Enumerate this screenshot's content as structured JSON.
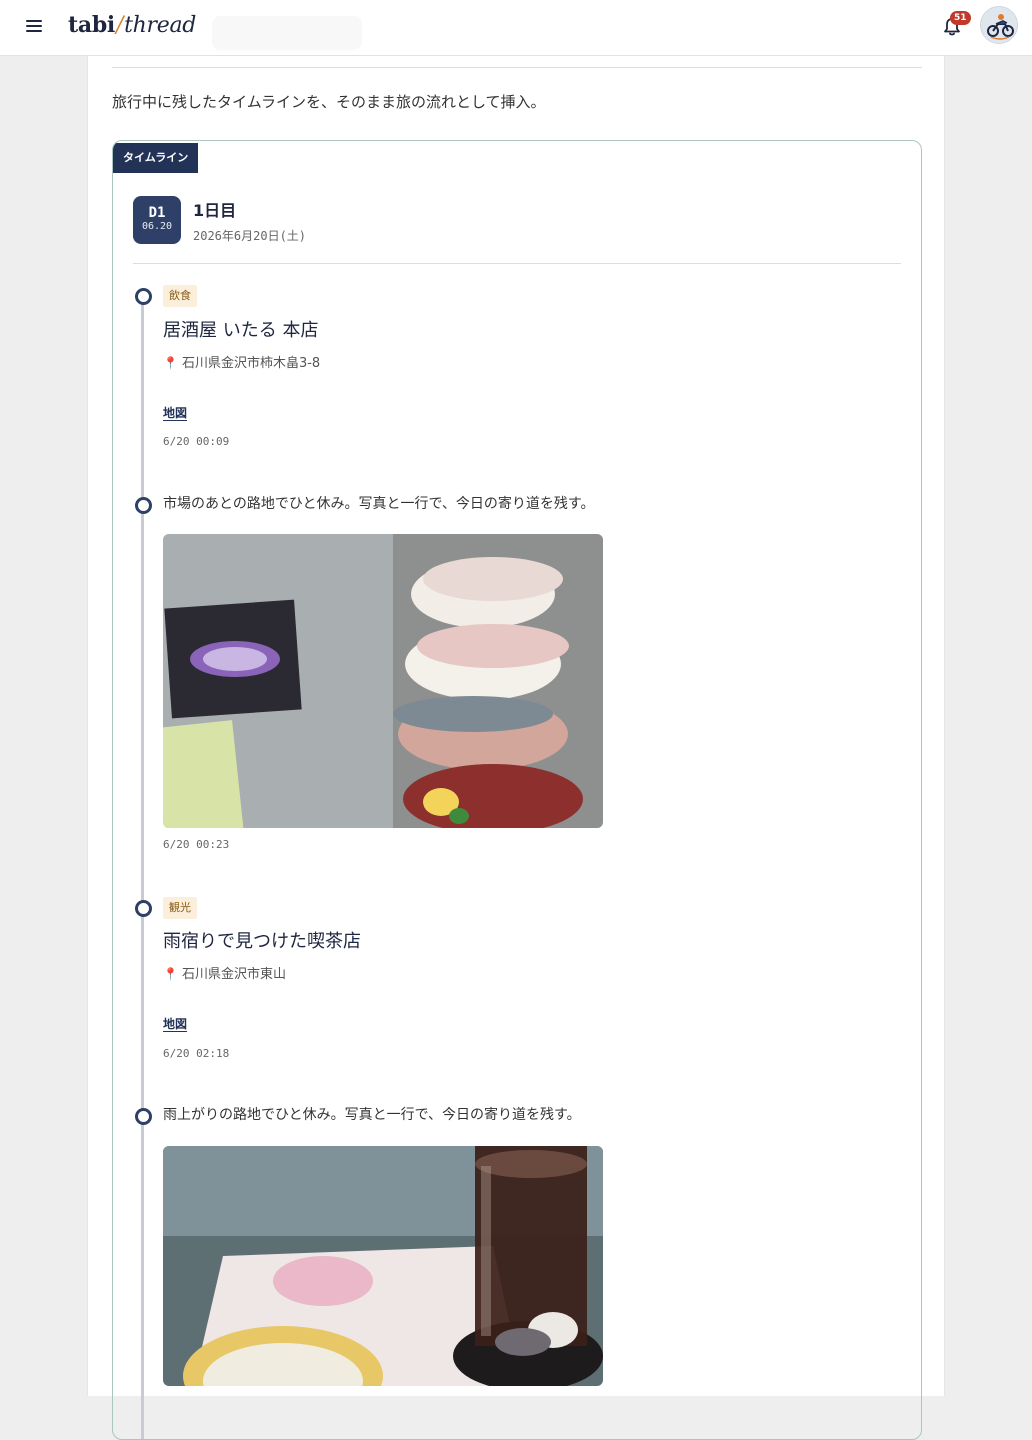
{
  "app": {
    "logo_main": "tabi",
    "logo_slash": "/",
    "logo_sub": "thread",
    "notification_count": "51",
    "icons": [
      "menu-icon",
      "bell-icon",
      "avatar-motorcycle-icon",
      "pin-icon"
    ]
  },
  "intro_text": "旅行中に残したタイムラインを、そのまま旅の流れとして挿入。",
  "timeline": {
    "tag": "タイムライン",
    "day": {
      "badge_day": "D1",
      "badge_date": "06.20",
      "title": "1日目",
      "date": "2026年6月20日(土)"
    },
    "entries": [
      {
        "category": "飲食",
        "place": "居酒屋 いたる 本店",
        "address": "石川県金沢市柿木畠3-8",
        "map_label": "地図",
        "time": "6/20 00:09"
      },
      {
        "note": "市場のあとの路地でひと休み。写真と一行で、今日の寄り道を残す。",
        "photo": "sushi-photo",
        "time": "6/20 00:23"
      },
      {
        "category": "観光",
        "place": "雨宿りで見つけた喫茶店",
        "address": "石川県金沢市東山",
        "map_label": "地図",
        "time": "6/20 02:18"
      },
      {
        "note": "雨上がりの路地でひと休み。写真と一行で、今日の寄り道を残す。",
        "photo": "cafe-photo"
      }
    ]
  },
  "colors": {
    "navy": "#233257",
    "accent_orange": "#d9822b",
    "badge_red": "#c0392b",
    "category_bg": "#fbefdc",
    "timeline_border": "#a9c7c0"
  }
}
